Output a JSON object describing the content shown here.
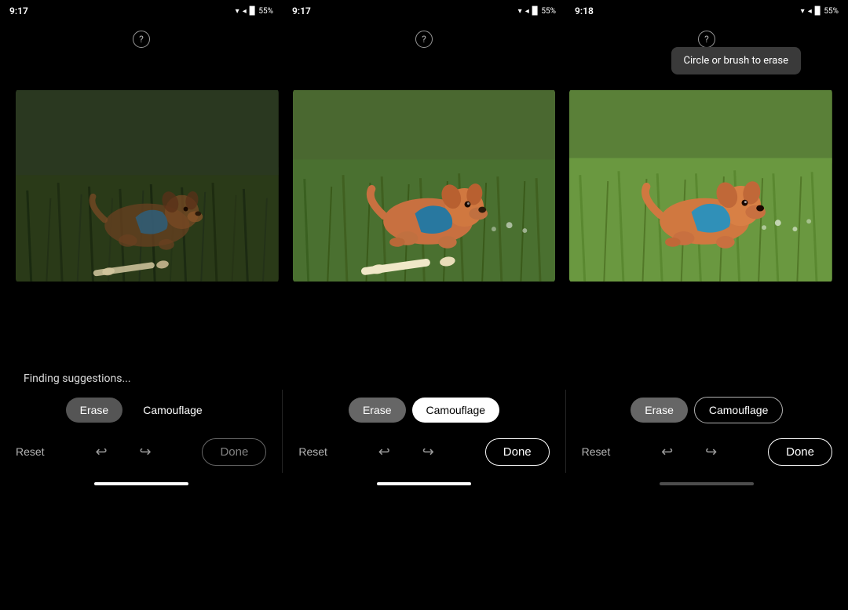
{
  "statusBars": [
    {
      "time": "9:17",
      "icons": "▼◀ 55%"
    },
    {
      "time": "9:17",
      "icons": "▼◀ 55%"
    },
    {
      "time": "9:18",
      "icons": "▼◀ 55%"
    }
  ],
  "tooltip": {
    "text": "Circle or brush to erase"
  },
  "findingLabel": "Finding suggestions...",
  "panels": [
    {
      "id": "panel1",
      "eraseLabel": "Erase",
      "camouflageLabel": "Camouflage",
      "eraseActive": false,
      "camouflageActive": false,
      "resetLabel": "Reset",
      "doneLabel": "Done",
      "doneActive": false
    },
    {
      "id": "panel2",
      "eraseLabel": "Erase",
      "camouflageLabel": "Camouflage",
      "eraseActive": true,
      "camouflageActive": true,
      "resetLabel": "Reset",
      "doneLabel": "Done",
      "doneActive": true
    },
    {
      "id": "panel3",
      "eraseLabel": "Erase",
      "camouflageLabel": "Camouflage",
      "eraseActive": true,
      "camouflageActive": false,
      "resetLabel": "Reset",
      "doneLabel": "Done",
      "doneActive": true
    }
  ],
  "icons": {
    "help": "?",
    "undo": "↩",
    "redo": "↪"
  }
}
